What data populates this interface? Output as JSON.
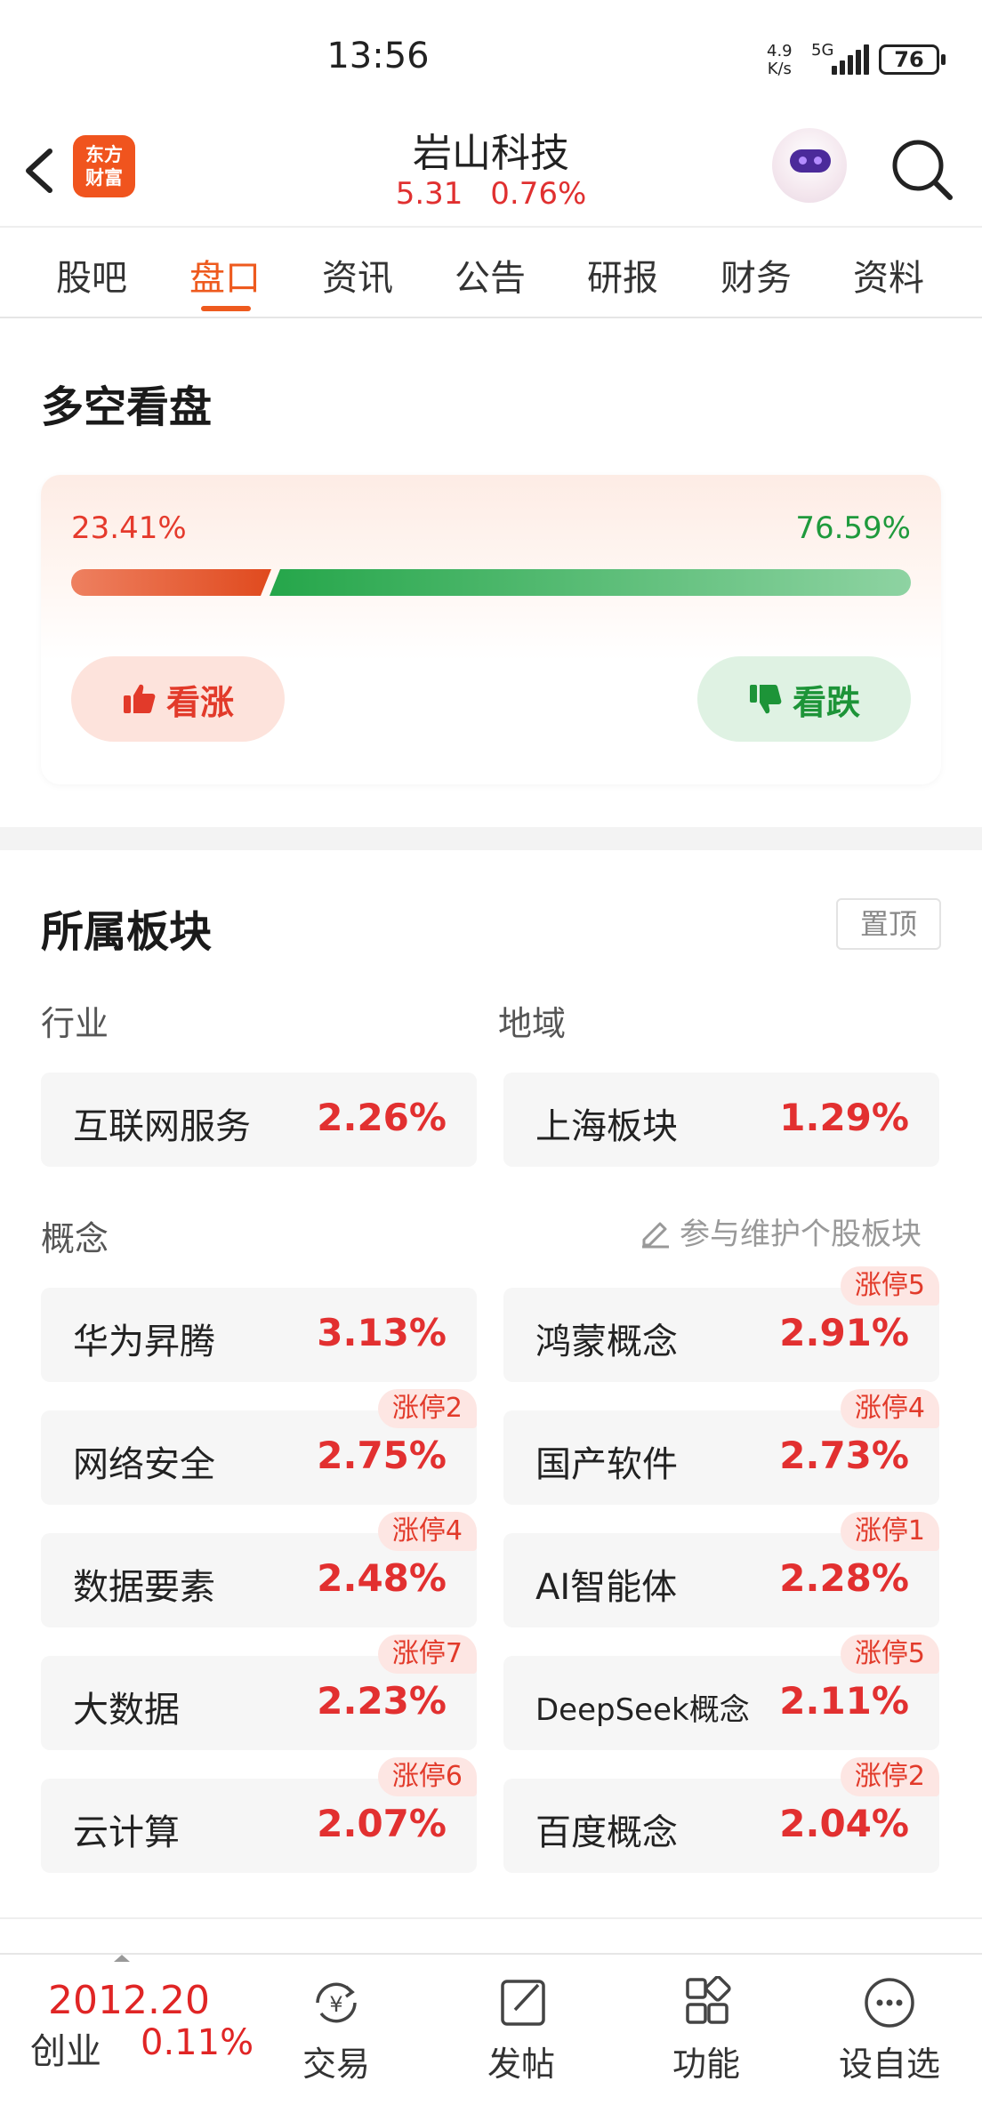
{
  "status_bar": {
    "time": "13:56",
    "net_speed_top": "4.9",
    "net_speed_unit": "K/s",
    "network": "5G",
    "battery": "76"
  },
  "header": {
    "logo_line1": "东方",
    "logo_line2": "财富",
    "stock_name": "岩山科技",
    "price": "5.31",
    "change_pct": "0.76%"
  },
  "tabs": [
    {
      "label": "股吧"
    },
    {
      "label": "盘口"
    },
    {
      "label": "资讯"
    },
    {
      "label": "公告"
    },
    {
      "label": "研报"
    },
    {
      "label": "财务"
    },
    {
      "label": "资料"
    }
  ],
  "active_tab": "盘口",
  "sentiment": {
    "title": "多空看盘",
    "bull_pct_label": "23.41%",
    "bear_pct_label": "76.59%",
    "bull_fraction": 0.2341,
    "bull_button": "看涨",
    "bear_button": "看跌",
    "colors": {
      "bull": "#e23a2a",
      "bear": "#1d9438"
    }
  },
  "sectors": {
    "title": "所属板块",
    "pin_label": "置顶",
    "industry_label": "行业",
    "region_label": "地域",
    "industry": {
      "name": "互联网服务",
      "pct": "2.26%"
    },
    "region": {
      "name": "上海板块",
      "pct": "1.29%"
    },
    "concept_label": "概念",
    "maintain_label": "参与维护个股板块",
    "concepts": [
      {
        "name": "华为昇腾",
        "pct": "3.13%",
        "badge": ""
      },
      {
        "name": "鸿蒙概念",
        "pct": "2.91%",
        "badge": "涨停5"
      },
      {
        "name": "网络安全",
        "pct": "2.75%",
        "badge": "涨停2"
      },
      {
        "name": "国产软件",
        "pct": "2.73%",
        "badge": "涨停4"
      },
      {
        "name": "数据要素",
        "pct": "2.48%",
        "badge": "涨停4"
      },
      {
        "name": "AI智能体",
        "pct": "2.28%",
        "badge": "涨停1"
      },
      {
        "name": "大数据",
        "pct": "2.23%",
        "badge": "涨停7"
      },
      {
        "name": "DeepSeek概念",
        "pct": "2.11%",
        "badge": "涨停5"
      },
      {
        "name": "云计算",
        "pct": "2.07%",
        "badge": "涨停6"
      },
      {
        "name": "百度概念",
        "pct": "2.04%",
        "badge": "涨停2"
      }
    ]
  },
  "bottom_bar": {
    "index_value": "2012.20",
    "index_name": "创业",
    "index_pct": "0.11%",
    "items": [
      {
        "label": "交易",
        "icon": "yuan-cycle-icon"
      },
      {
        "label": "发帖",
        "icon": "edit-icon"
      },
      {
        "label": "功能",
        "icon": "grid-icon"
      },
      {
        "label": "设自选",
        "icon": "more-icon"
      }
    ]
  }
}
